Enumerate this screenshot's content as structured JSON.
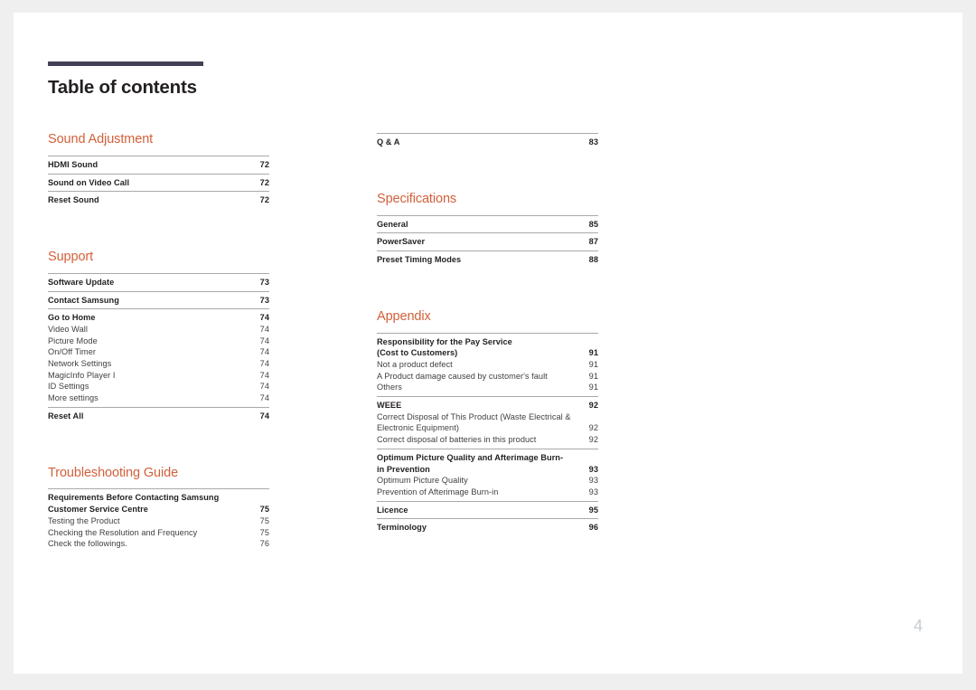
{
  "document": {
    "title": "Table of contents",
    "folio": "4",
    "accent_color": "#d2603a",
    "rule_color": "#454056",
    "folio_color": "#c6ccd2"
  },
  "columns": {
    "left": [
      {
        "heading": "Sound Adjustment",
        "groups": [
          {
            "entries": [
              {
                "label": "HDMI Sound",
                "page": "72",
                "level": "major"
              }
            ]
          },
          {
            "entries": [
              {
                "label": "Sound on Video Call",
                "page": "72",
                "level": "major"
              }
            ]
          },
          {
            "entries": [
              {
                "label": "Reset Sound",
                "page": "72",
                "level": "major"
              }
            ]
          }
        ]
      },
      {
        "heading": "Support",
        "groups": [
          {
            "entries": [
              {
                "label": "Software Update",
                "page": "73",
                "level": "major"
              }
            ]
          },
          {
            "entries": [
              {
                "label": "Contact Samsung",
                "page": "73",
                "level": "major"
              }
            ]
          },
          {
            "entries": [
              {
                "label": "Go to Home",
                "page": "74",
                "level": "major"
              },
              {
                "label": "Video Wall",
                "page": "74",
                "level": "minor"
              },
              {
                "label": "Picture Mode",
                "page": "74",
                "level": "minor"
              },
              {
                "label": "On/Off Timer",
                "page": "74",
                "level": "minor"
              },
              {
                "label": "Network Settings",
                "page": "74",
                "level": "minor"
              },
              {
                "label": "MagicInfo Player I",
                "page": "74",
                "level": "minor"
              },
              {
                "label": "ID Settings",
                "page": "74",
                "level": "minor"
              },
              {
                "label": "More settings",
                "page": "74",
                "level": "minor"
              }
            ]
          },
          {
            "entries": [
              {
                "label": "Reset All",
                "page": "74",
                "level": "major"
              }
            ]
          }
        ]
      },
      {
        "heading": "Troubleshooting Guide",
        "groups": [
          {
            "entries": [
              {
                "label": "Requirements Before Contacting Samsung",
                "page": "",
                "level": "major",
                "wrap": true
              },
              {
                "label": "Customer Service Centre",
                "page": "75",
                "level": "major"
              },
              {
                "label": "Testing the Product",
                "page": "75",
                "level": "minor"
              },
              {
                "label": "Checking the Resolution and Frequency",
                "page": "75",
                "level": "minor"
              },
              {
                "label": "Check the followings.",
                "page": "76",
                "level": "minor"
              }
            ]
          }
        ]
      }
    ],
    "right": [
      {
        "heading": "",
        "groups": [
          {
            "entries": [
              {
                "label": "Q & A",
                "page": "83",
                "level": "major"
              }
            ]
          }
        ]
      },
      {
        "heading": "Specifications",
        "groups": [
          {
            "entries": [
              {
                "label": "General",
                "page": "85",
                "level": "major"
              }
            ]
          },
          {
            "entries": [
              {
                "label": "PowerSaver",
                "page": "87",
                "level": "major"
              }
            ]
          },
          {
            "entries": [
              {
                "label": "Preset Timing Modes",
                "page": "88",
                "level": "major"
              }
            ]
          }
        ]
      },
      {
        "heading": "Appendix",
        "groups": [
          {
            "entries": [
              {
                "label": "Responsibility for the Pay Service",
                "page": "",
                "level": "major",
                "wrap": true
              },
              {
                "label": "(Cost to Customers)",
                "page": "91",
                "level": "major"
              },
              {
                "label": "Not a product defect",
                "page": "91",
                "level": "minor"
              },
              {
                "label": "A Product damage caused by customer's fault",
                "page": "91",
                "level": "minor"
              },
              {
                "label": "Others",
                "page": "91",
                "level": "minor"
              }
            ]
          },
          {
            "entries": [
              {
                "label": "WEEE",
                "page": "92",
                "level": "major"
              },
              {
                "label": "Correct Disposal of This Product (Waste Electrical &",
                "page": "",
                "level": "minor",
                "wrap": true
              },
              {
                "label": "Electronic Equipment)",
                "page": "92",
                "level": "minor"
              },
              {
                "label": "Correct disposal of batteries in this product",
                "page": "92",
                "level": "minor"
              }
            ]
          },
          {
            "entries": [
              {
                "label": "Optimum Picture Quality and Afterimage Burn-",
                "page": "",
                "level": "major",
                "wrap": true
              },
              {
                "label": "in Prevention",
                "page": "93",
                "level": "major"
              },
              {
                "label": "Optimum Picture Quality",
                "page": "93",
                "level": "minor"
              },
              {
                "label": "Prevention of Afterimage Burn-in",
                "page": "93",
                "level": "minor"
              }
            ]
          },
          {
            "entries": [
              {
                "label": "Licence",
                "page": "95",
                "level": "major"
              }
            ]
          },
          {
            "entries": [
              {
                "label": "Terminology",
                "page": "96",
                "level": "major"
              }
            ]
          }
        ]
      }
    ]
  }
}
